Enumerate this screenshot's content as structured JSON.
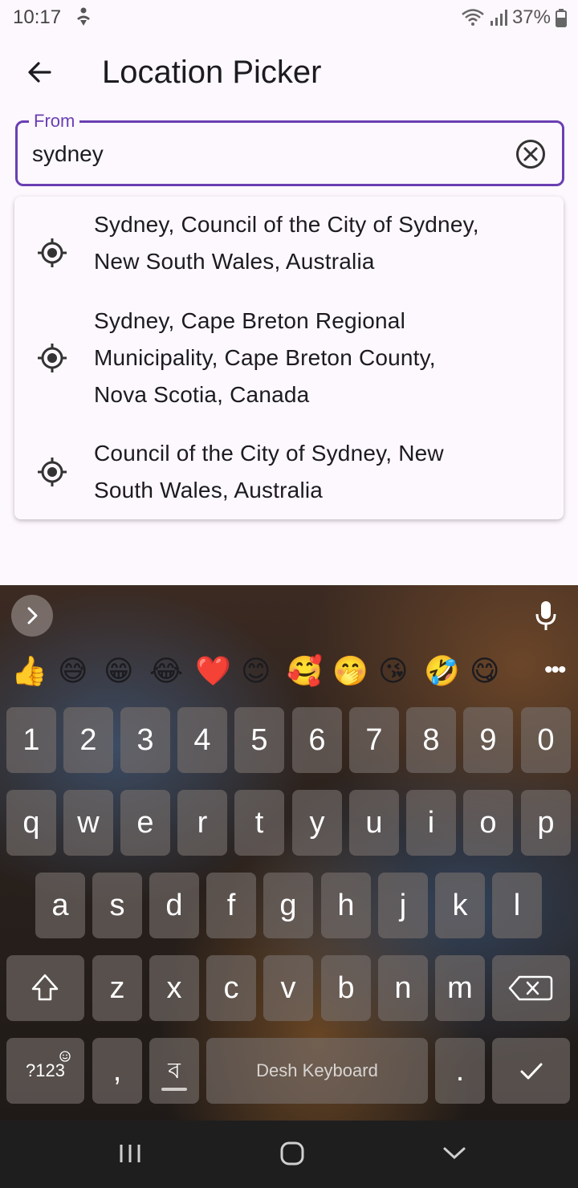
{
  "status_bar": {
    "time": "10:17",
    "battery": "37%"
  },
  "app_bar": {
    "title": "Location Picker"
  },
  "from_field": {
    "label": "From",
    "value": "sydney"
  },
  "suggestions": [
    {
      "line1": "Sydney, Council of the City of Sydney,",
      "line2": "New South Wales, Australia",
      "line3": ""
    },
    {
      "line1": "Sydney, Cape Breton Regional",
      "line2": "Municipality, Cape Breton County,",
      "line3": "Nova Scotia, Canada"
    },
    {
      "line1": "Council of the City of Sydney, New",
      "line2": "South Wales, Australia",
      "line3": ""
    }
  ],
  "keyboard": {
    "emojis": [
      "👍",
      "😅",
      "😁",
      "😂",
      "❤️",
      "😊",
      "🥰",
      "🤭",
      "😘",
      "🤣",
      "😋"
    ],
    "number_row": [
      "1",
      "2",
      "3",
      "4",
      "5",
      "6",
      "7",
      "8",
      "9",
      "0"
    ],
    "row1": [
      "q",
      "w",
      "e",
      "r",
      "t",
      "y",
      "u",
      "i",
      "o",
      "p"
    ],
    "row2": [
      "a",
      "s",
      "d",
      "f",
      "g",
      "h",
      "j",
      "k",
      "l"
    ],
    "row3": [
      "z",
      "x",
      "c",
      "v",
      "b",
      "n",
      "m"
    ],
    "symbols_key": "?123",
    "comma_key": ",",
    "lang_key": "ব",
    "space_label": "Desh Keyboard",
    "period_key": "."
  },
  "icons": {
    "back": "arrow-left-icon",
    "clear": "clear-circle-icon",
    "suggestion": "my-location-icon",
    "mic": "mic-icon"
  },
  "colors": {
    "accent": "#6b3fb2",
    "background": "#fdf8fd"
  }
}
